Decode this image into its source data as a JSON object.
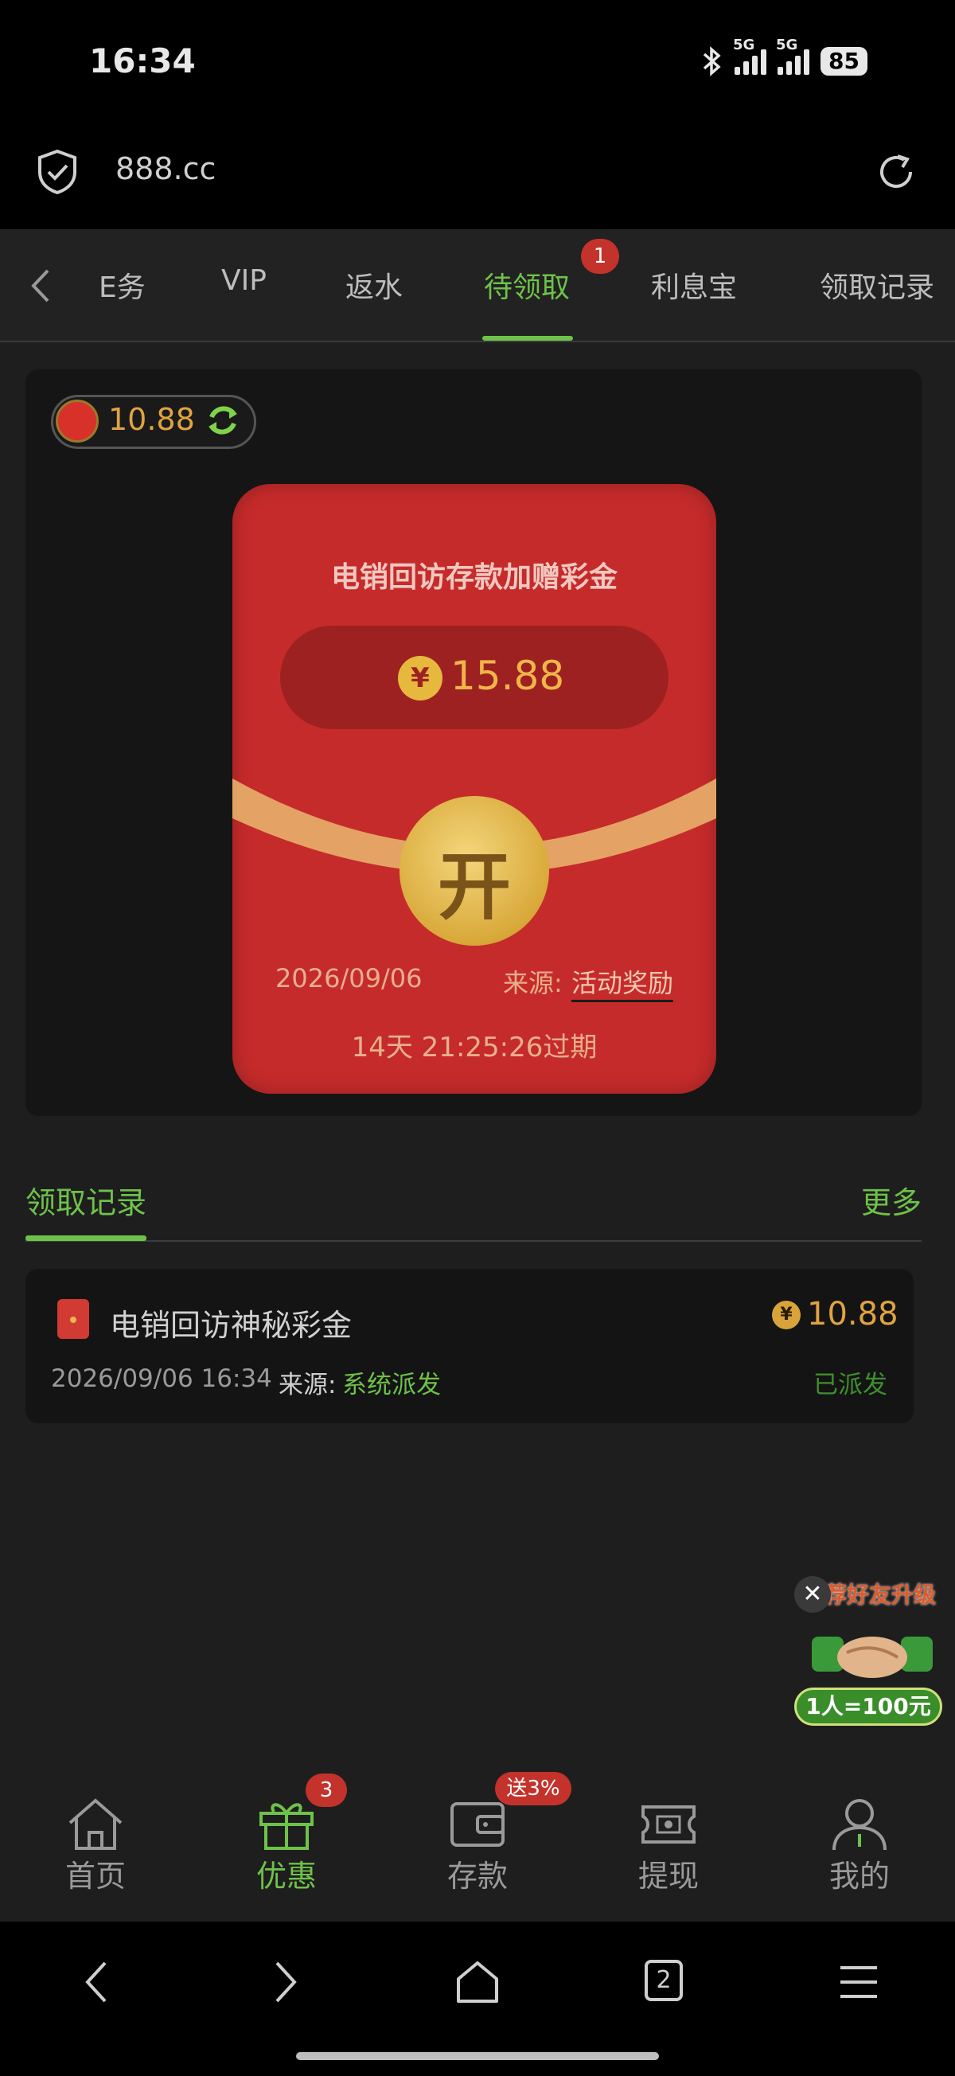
{
  "status_bar": {
    "time": "16:34",
    "network1": "5G",
    "network2": "5G",
    "battery": "85"
  },
  "browser": {
    "url": "888.cc"
  },
  "tabs": {
    "items": [
      {
        "label": "E务"
      },
      {
        "label": "VIP"
      },
      {
        "label": "返水"
      },
      {
        "label": "待领取",
        "badge": "1",
        "active": true
      },
      {
        "label": "利息宝"
      },
      {
        "label": "领取记录"
      }
    ]
  },
  "balance": {
    "value": "10.88"
  },
  "envelope": {
    "title": "电销回访存款加赠彩金",
    "currency_symbol": "¥",
    "amount": "15.88",
    "open_label": "开",
    "date": "2026/09/06",
    "source_label": "来源:",
    "source_value": "活动奖励",
    "expire_text": "14天 21:25:26过期"
  },
  "records": {
    "title": "领取记录",
    "more": "更多",
    "items": [
      {
        "name": "电销回访神秘彩金",
        "coin_symbol": "¥",
        "amount": "10.88",
        "datetime": "2026/09/06 16:34",
        "source_label": "来源:",
        "source_value": "系统派发",
        "status": "已派发"
      }
    ]
  },
  "promo": {
    "title": "推荐好友升级",
    "close": "✕",
    "reward": "1人=100元"
  },
  "bottom_nav": {
    "items": [
      {
        "label": "首页",
        "icon": "home-icon"
      },
      {
        "label": "优惠",
        "icon": "gift-icon",
        "badge": "3",
        "active": true
      },
      {
        "label": "存款",
        "icon": "wallet-icon",
        "badge": "送3%"
      },
      {
        "label": "提现",
        "icon": "cash-icon"
      },
      {
        "label": "我的",
        "icon": "user-icon"
      }
    ]
  },
  "system_nav": {
    "tab_count": "2"
  },
  "colors": {
    "accent": "#6ec24a",
    "envelope_red": "#c62b2b",
    "gold": "#e0a341",
    "badge_red": "#c3332b"
  }
}
